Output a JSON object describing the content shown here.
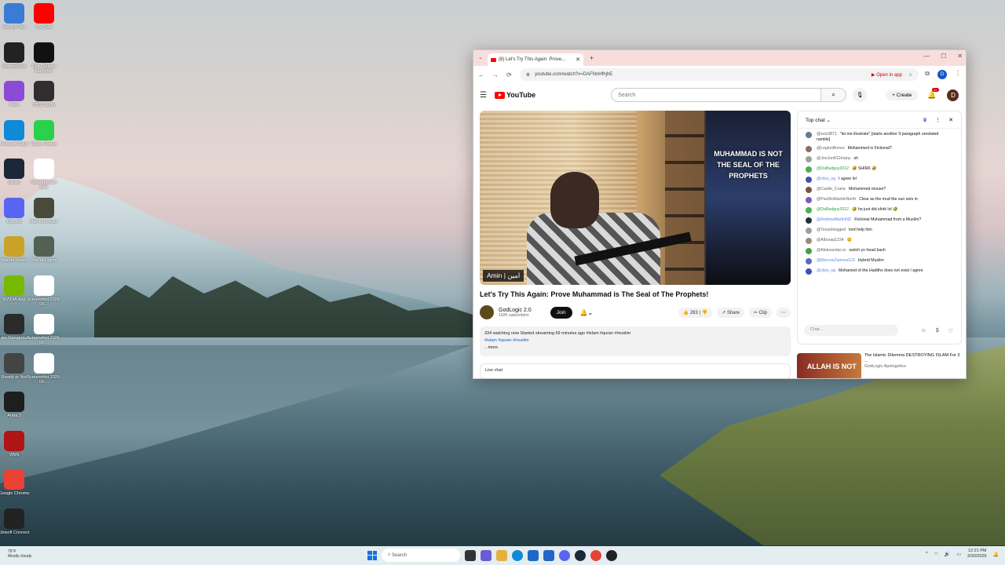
{
  "desktop": {
    "icons_left": [
      {
        "label": "Recycle Bin",
        "icon": "recycle-bin-icon",
        "color": "#3a7bd5"
      },
      {
        "label": "StreamDeck",
        "icon": "stream-deck-icon",
        "color": "#222222"
      },
      {
        "label": "Paint",
        "icon": "paint-icon",
        "color": "#8c4bd6"
      },
      {
        "label": "Microsoft Edge",
        "icon": "edge-icon",
        "color": "#0f8ad8"
      },
      {
        "label": "Steam",
        "icon": "steam-icon",
        "color": "#1b2838"
      },
      {
        "label": "Discord",
        "icon": "discord-icon",
        "color": "#5865f2"
      },
      {
        "label": "Marvel Rivals",
        "icon": "marvel-rivals-icon",
        "color": "#c9a227"
      },
      {
        "label": "NVIDIA App",
        "icon": "nvidia-icon",
        "color": "#76b900"
      },
      {
        "label": "Lies Dangerous",
        "icon": "game-icon",
        "color": "#2b2b2b"
      },
      {
        "label": "Ready or Not",
        "icon": "ready-or-not-icon",
        "color": "#444444"
      },
      {
        "label": "Arma 3",
        "icon": "arma-icon",
        "color": "#1e1e1e"
      },
      {
        "label": "VBIN",
        "icon": "vbin-icon",
        "color": "#b01515"
      },
      {
        "label": "Google Chrome",
        "icon": "chrome-icon",
        "color": "#e94235"
      },
      {
        "label": "Ubisoft Connect",
        "icon": "ubisoft-icon",
        "color": "#222222"
      }
    ],
    "icons_right": [
      {
        "label": "YouTube",
        "icon": "youtube-icon",
        "color": "#ff0000"
      },
      {
        "label": "Epic Games Launcher",
        "icon": "epic-games-icon",
        "color": "#111111"
      },
      {
        "label": "OBS Studio",
        "icon": "obs-icon",
        "color": "#302e31"
      },
      {
        "label": "Razer Cortex",
        "icon": "razer-icon",
        "color": "#2ad14a"
      },
      {
        "label": "Meta Horizon Link",
        "icon": "meta-icon",
        "color": "#ffffff"
      },
      {
        "label": "Hell Let Loose",
        "icon": "hell-let-loose-icon",
        "color": "#4a4a3a"
      },
      {
        "label": "War of Rights",
        "icon": "war-of-rights-icon",
        "color": "#556055"
      },
      {
        "label": "Screenshot 2026-03-...",
        "icon": "screenshot-file-icon",
        "color": "#ffffff"
      },
      {
        "label": "Screenshot 2026-03-...",
        "icon": "screenshot-file-icon",
        "color": "#ffffff"
      },
      {
        "label": "Screenshot 2026-03-...",
        "icon": "screenshot-file-icon",
        "color": "#ffffff"
      }
    ]
  },
  "browser": {
    "tab_title": "(8) Let's Try This Again: Prove...",
    "url": "youtube.com/watch?v=DAFNnHfhjhE",
    "open_in_app": "Open in app",
    "profile_initial": "D"
  },
  "youtube": {
    "logo_text": "YouTube",
    "search_placeholder": "Search",
    "create_label": "Create",
    "notif_badge": "9+",
    "avatar_initial": "D",
    "video": {
      "overlay_text": "MUHAMMAD IS NOT THE SEAL OF THE PROPHETS",
      "name_tag": "Amin | امين",
      "title": "Let's Try This Again: Prove Muhammad is The Seal of The Prophets!"
    },
    "channel": {
      "name": "GodLogic 2.0",
      "subs": "102K subscribers",
      "join": "Join"
    },
    "actions": {
      "likes": "283",
      "share": "Share",
      "clip": "Clip",
      "more": "⋯"
    },
    "description": {
      "line1": "334 watching now  Started streaming 69 minutes ago  #islam #quran #muslim",
      "line2": "#islam #quran #muslim",
      "more": "...more"
    },
    "live_chat_label": "Live chat",
    "chat": {
      "header": "Top chat",
      "placeholder": "Chat...",
      "messages": [
        {
          "user": "@svw3871",
          "text": "\"let me illustrate\" [starts another 9 paragraph unrelated ramble]",
          "color": "#607d8b",
          "type": "normal"
        },
        {
          "user": "@LegionBones",
          "text": "Mohammed is Fictional?",
          "color": "#8d6e63",
          "type": "normal"
        },
        {
          "user": "@JonJon812many",
          "text": "oh",
          "color": "#9e9e9e",
          "type": "normal"
        },
        {
          "user": "@DaBadguy2012",
          "text": "🤣 SHIRK 🤣",
          "color": "#4caf50",
          "type": "member"
        },
        {
          "user": "@cliss_og",
          "text": "I agree lol",
          "color": "#3f51b5",
          "type": "mod"
        },
        {
          "user": "@Castle_Crane",
          "text": "Mohammed mouse?",
          "color": "#795548",
          "type": "normal"
        },
        {
          "user": "@PacificAtlanticNorth",
          "text": "Clear as the mud the sun sets in",
          "color": "#7e57c2",
          "type": "normal"
        },
        {
          "user": "@DaBadguy2012",
          "text": "🤣 he just did shirk lol 🤣",
          "color": "#4caf50",
          "type": "member"
        },
        {
          "user": "@AndrewMartinNZ",
          "text": "Fictional Muhammad from a Muslim?",
          "color": "#263238",
          "type": "mod"
        },
        {
          "user": "@TexasHogged",
          "text": "lord help him",
          "color": "#9e9e9e",
          "type": "normal"
        },
        {
          "user": "@Alburaq1234",
          "text": "😊",
          "color": "#a1887f",
          "type": "normal"
        },
        {
          "user": "@Aleksandar.xx",
          "text": "watch yo head bash",
          "color": "#43a047",
          "type": "normal"
        },
        {
          "user": "@MarcosZamora123",
          "text": "Hybrid Muslim",
          "color": "#5c6bc0",
          "type": "mod"
        },
        {
          "user": "@cliss_og",
          "text": "Mohamed of the Hadiths does not exist I agree",
          "color": "#3f51b5",
          "type": "mod"
        }
      ]
    },
    "recommended": {
      "thumb_text": "ALLAH IS NOT",
      "title": "The Islamic Dilemma DESTROYING ISLAM For 3 ...",
      "channel": "GodLogic Apologetics"
    }
  },
  "taskbar": {
    "weather_temp": "76°F",
    "weather_desc": "Mostly cloudy",
    "search_placeholder": "Search",
    "time": "12:21 PM",
    "date": "3/30/2026"
  }
}
